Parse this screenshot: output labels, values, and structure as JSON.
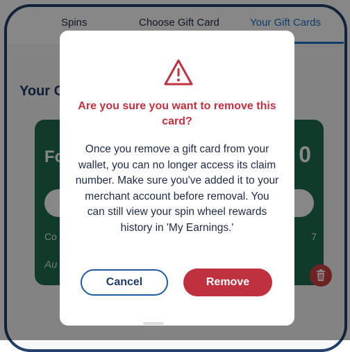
{
  "tabs": [
    {
      "label": "Spins"
    },
    {
      "label": "Choose Gift Card"
    },
    {
      "label": "Your Gift Cards",
      "active": true
    }
  ],
  "page": {
    "title": "Your Gift Cards"
  },
  "gift_card": {
    "brand": "Fo",
    "amount": "0",
    "code_label": "Co",
    "code_suffix": "7",
    "auto_label": "Au",
    "color": "#1f6f4f"
  },
  "modal": {
    "icon": "warning-triangle-icon",
    "title": "Are you sure you want to remove this card?",
    "body": "Once you remove a gift card from your wallet, you can no longer access its claim number. Make sure you've added it to your merchant account before removal. You can still view your spin wheel rewards history in 'My Earnings.'",
    "cancel_label": "Cancel",
    "remove_label": "Remove"
  },
  "colors": {
    "accent_red": "#c0313f",
    "accent_blue": "#1a73c9",
    "navy": "#1f3a66",
    "trash_red": "#d04040"
  }
}
